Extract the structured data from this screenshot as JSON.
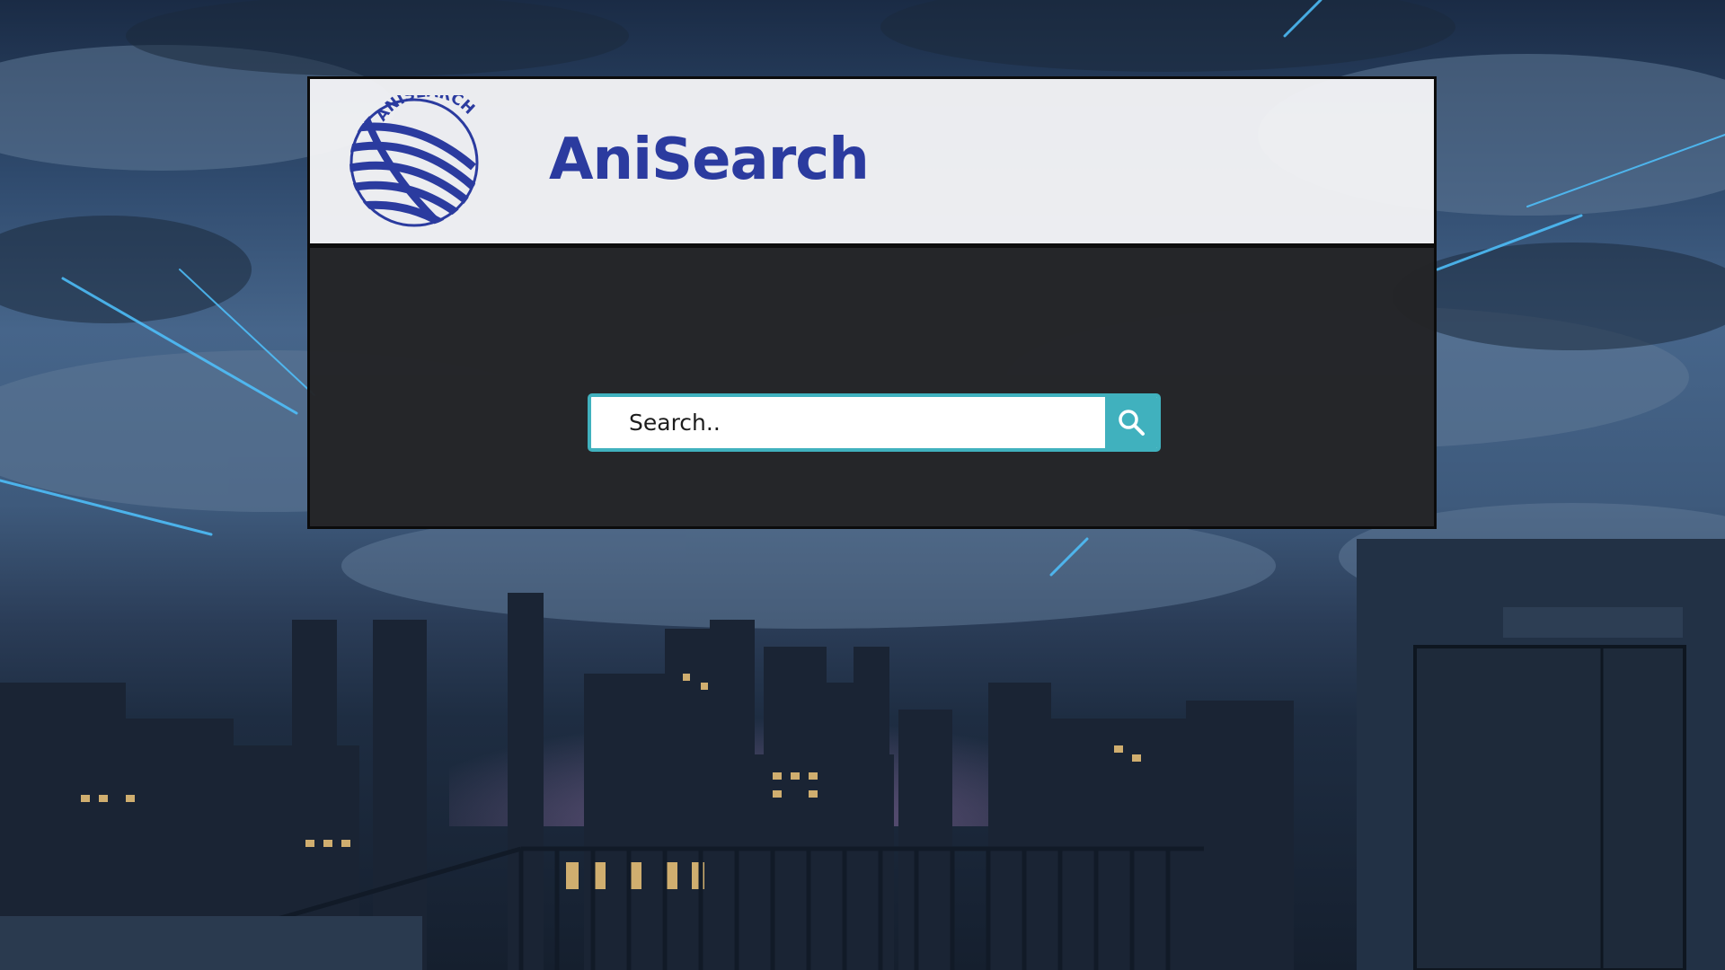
{
  "app": {
    "title": "AniSearch",
    "logo_text": "ANISEARCH",
    "title_color": "#2b3b9f"
  },
  "search": {
    "placeholder": "Search..",
    "value": "",
    "accent_color": "#40b1be",
    "button_icon": "search-icon"
  },
  "background": {
    "description_icon": "night-city-rooftop-scene"
  }
}
